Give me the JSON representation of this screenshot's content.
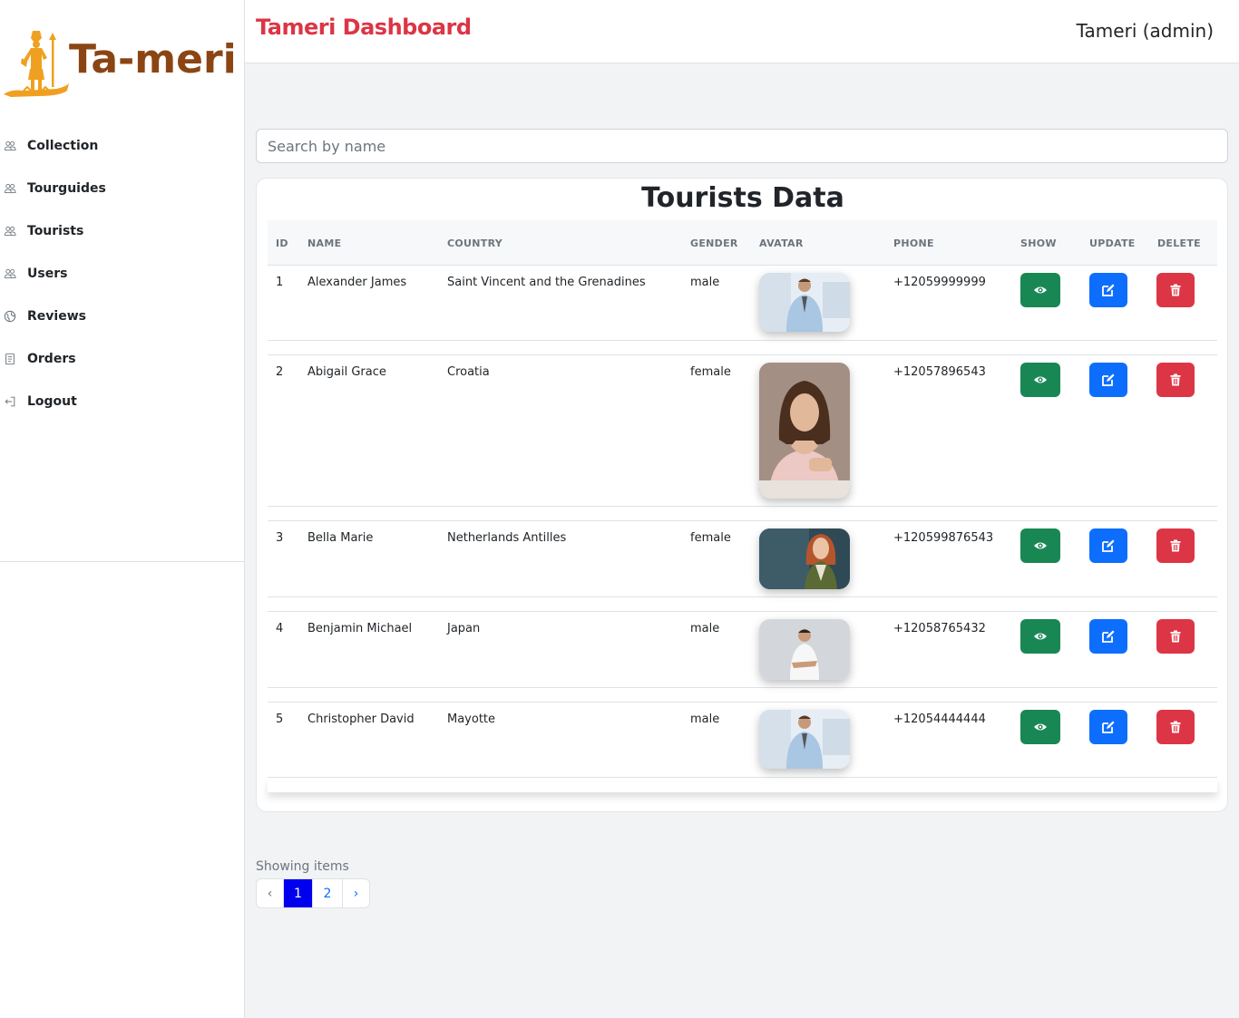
{
  "sidebar": {
    "logo_text": "Ta-meri",
    "items": [
      {
        "label": "Collection",
        "icon": "users-icon"
      },
      {
        "label": "Tourguides",
        "icon": "users-icon"
      },
      {
        "label": "Tourists",
        "icon": "users-icon"
      },
      {
        "label": "Users",
        "icon": "users-icon"
      },
      {
        "label": "Reviews",
        "icon": "globe-icon"
      },
      {
        "label": "Orders",
        "icon": "document-icon"
      },
      {
        "label": "Logout",
        "icon": "logout-icon"
      }
    ]
  },
  "header": {
    "title": "Tameri Dashboard",
    "user": "Tameri (admin)"
  },
  "search": {
    "placeholder": "Search by name"
  },
  "table": {
    "title": "Tourists Data",
    "columns": [
      "ID",
      "NAME",
      "COUNTRY",
      "GENDER",
      "AVATAR",
      "PHONE",
      "SHOW",
      "UPDATE",
      "DELETE"
    ],
    "rows": [
      {
        "id": "1",
        "name": "Alexander James",
        "country": "Saint Vincent and the Grenadines",
        "gender": "male",
        "phone": "+12059999999",
        "avatar": "man-in-office-photo"
      },
      {
        "id": "2",
        "name": "Abigail Grace",
        "country": "Croatia",
        "gender": "female",
        "phone": "+12057896543",
        "avatar": "woman-portrait-photo"
      },
      {
        "id": "3",
        "name": "Bella Marie",
        "country": "Netherlands Antilles",
        "gender": "female",
        "phone": "+120599876543",
        "avatar": "woman-red-hair-photo"
      },
      {
        "id": "4",
        "name": "Benjamin Michael",
        "country": "Japan",
        "gender": "male",
        "phone": "+12058765432",
        "avatar": "man-white-tshirt-photo"
      },
      {
        "id": "5",
        "name": "Christopher David",
        "country": "Mayotte",
        "gender": "male",
        "phone": "+12054444444",
        "avatar": "man-in-office-photo"
      }
    ]
  },
  "pagination": {
    "showing_label": "Showing items",
    "prev": "‹",
    "pages": [
      "1",
      "2"
    ],
    "active_page": "1",
    "next": "›"
  },
  "colors": {
    "title_red": "#dc3545",
    "logo_brown": "#8b4513",
    "logo_gold": "#f0a020",
    "show_green": "#198754",
    "update_blue": "#0d6efd",
    "delete_red": "#dc3545",
    "active_page": "#0000ee"
  }
}
